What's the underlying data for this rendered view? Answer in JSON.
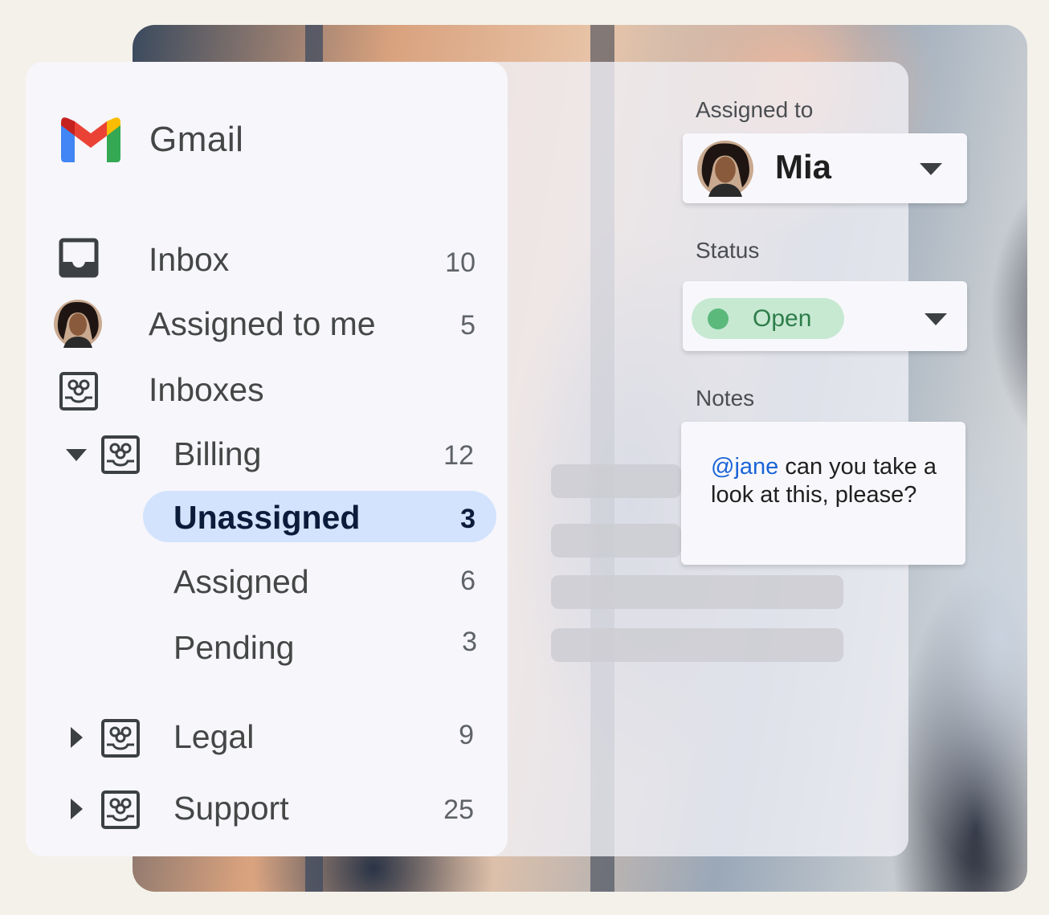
{
  "app": {
    "name": "Gmail"
  },
  "nav": {
    "inbox": {
      "label": "Inbox",
      "count": "10"
    },
    "assigned_to_me": {
      "label": "Assigned to me",
      "count": "5"
    },
    "inboxes": {
      "label": "Inboxes"
    },
    "billing": {
      "label": "Billing",
      "count": "12"
    },
    "unassigned": {
      "label": "Unassigned",
      "count": "3"
    },
    "assigned": {
      "label": "Assigned",
      "count": "6"
    },
    "pending": {
      "label": "Pending",
      "count": "3"
    },
    "legal": {
      "label": "Legal",
      "count": "9"
    },
    "support": {
      "label": "Support",
      "count": "25"
    }
  },
  "details": {
    "assigned_to_label": "Assigned to",
    "assignee_name": "Mia",
    "status_label": "Status",
    "status_value": "Open",
    "notes_label": "Notes",
    "note_mention": "@jane",
    "note_text": " can you take a look at this, please?"
  },
  "colors": {
    "selected_pill": "#d3e3fd",
    "status_chip": "#c7e9d2",
    "status_dot": "#5bb97b",
    "mention": "#1a64d6"
  },
  "icons": {
    "inbox": "inbox-tray-icon",
    "group_inbox": "group-inbox-icon",
    "expand": "caret-down-icon",
    "collapse": "caret-right-icon",
    "dropdown": "dropdown-arrow-icon"
  }
}
